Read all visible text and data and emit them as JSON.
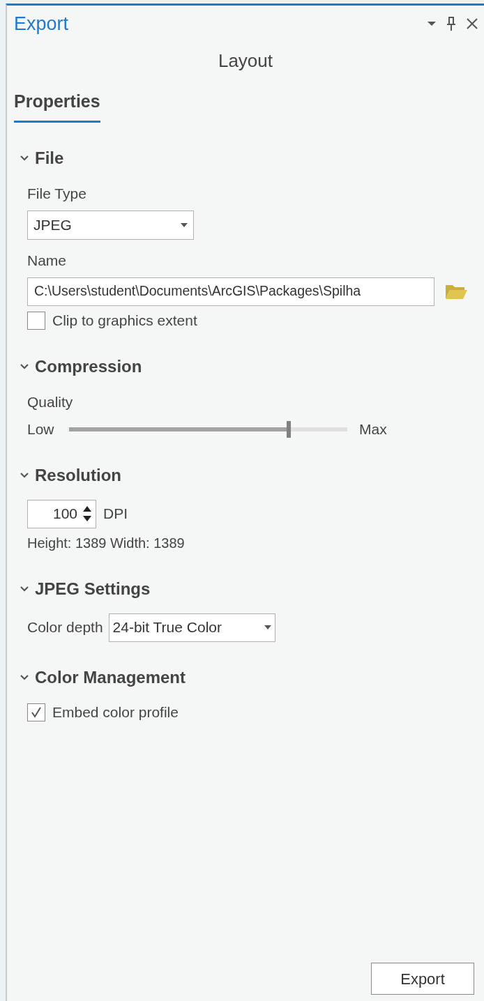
{
  "window": {
    "title": "Export"
  },
  "subtitle": "Layout",
  "tabs": [
    {
      "label": "Properties",
      "selected": true
    }
  ],
  "sections": [
    {
      "title": "File",
      "expanded": true,
      "rows": [
        {
          "kind": "label",
          "text": "File Type"
        },
        {
          "kind": "dropdown",
          "value": "JPEG"
        },
        {
          "kind": "label",
          "text": "Name"
        },
        {
          "kind": "path",
          "value": "C:\\Users\\student\\Documents\\ArcGIS\\Packages\\Spilha"
        },
        {
          "kind": "checkbox",
          "label": "Clip to graphics extent",
          "checked": false
        }
      ]
    },
    {
      "title": "Compression",
      "expanded": true,
      "rows": [
        {
          "kind": "label",
          "text": "Quality"
        },
        {
          "kind": "slider",
          "min_label": "Low",
          "max_label": "Max",
          "level": 0.79
        }
      ]
    },
    {
      "title": "Resolution",
      "expanded": true,
      "rows": [
        {
          "kind": "spinner",
          "value": "100",
          "unit": "DPI"
        },
        {
          "kind": "info",
          "text": "Height: 1389 Width: 1389"
        }
      ]
    },
    {
      "title": "JPEG Settings",
      "expanded": true,
      "rows": [
        {
          "kind": "labeled_dropdown",
          "label": "Color depth",
          "value": "24-bit True Color"
        }
      ]
    },
    {
      "title": "Color Management",
      "expanded": true,
      "rows": [
        {
          "kind": "checkbox",
          "label": "Embed color profile",
          "checked": true
        }
      ]
    }
  ],
  "buttons": [
    {
      "label": "Export"
    }
  ]
}
